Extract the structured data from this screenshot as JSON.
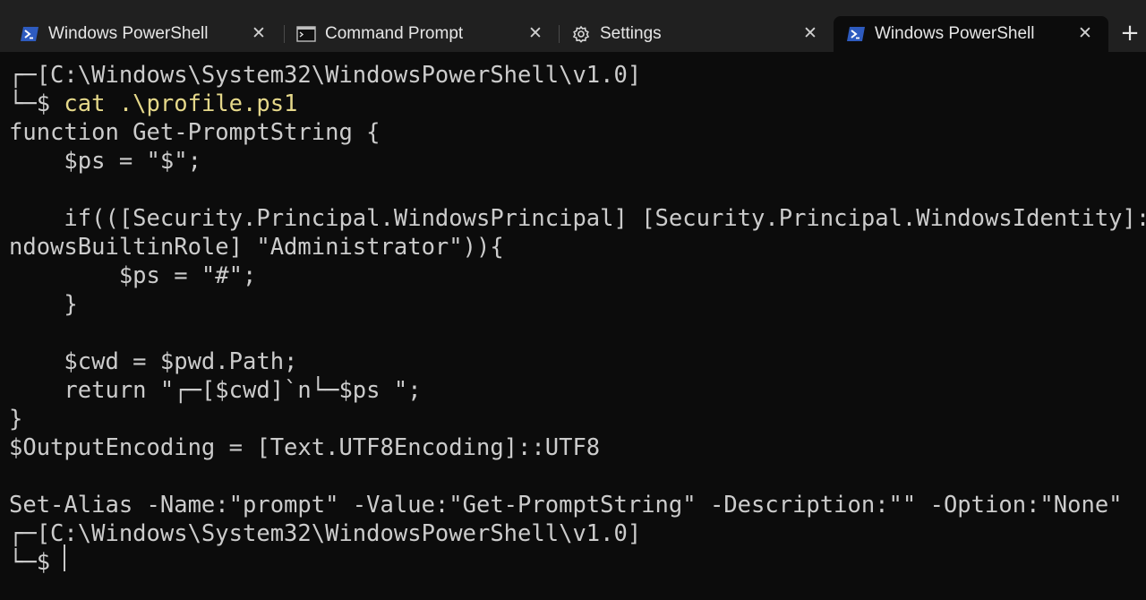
{
  "tabs": [
    {
      "label": "Windows PowerShell",
      "icon": "powershell-icon",
      "active": false
    },
    {
      "label": "Command Prompt",
      "icon": "command-prompt-icon",
      "active": false
    },
    {
      "label": "Settings",
      "icon": "gear-icon",
      "active": false
    },
    {
      "label": "Windows PowerShell",
      "icon": "powershell-icon",
      "active": true
    }
  ],
  "tab_close_glyph": "✕",
  "new_tab_glyph": "+",
  "colors": {
    "background": "#0c0c0c",
    "tabbar": "#202020",
    "text": "#cccccc",
    "command": "#e5d88a",
    "powershell_blue": "#2e5bbf"
  },
  "terminal": {
    "prompt1_path": "┌─[C:\\Windows\\System32\\WindowsPowerShell\\v1.0]",
    "prompt1_symbol": "└─$ ",
    "prompt1_command": "cat .\\profile.ps1",
    "output_lines": [
      "function Get-PromptString {",
      "    $ps = \"$\";",
      "",
      "    if(([Security.Principal.WindowsPrincipal] [Security.Principal.WindowsIdentity]::",
      "ndowsBuiltinRole] \"Administrator\")){",
      "        $ps = \"#\";",
      "    }",
      "",
      "    $cwd = $pwd.Path;",
      "    return \"┌─[$cwd]`n└─$ps \";",
      "}",
      "$OutputEncoding = [Text.UTF8Encoding]::UTF8",
      "",
      "Set-Alias -Name:\"prompt\" -Value:\"Get-PromptString\" -Description:\"\" -Option:\"None\""
    ],
    "prompt2_path": "┌─[C:\\Windows\\System32\\WindowsPowerShell\\v1.0]",
    "prompt2_symbol": "└─$ "
  }
}
